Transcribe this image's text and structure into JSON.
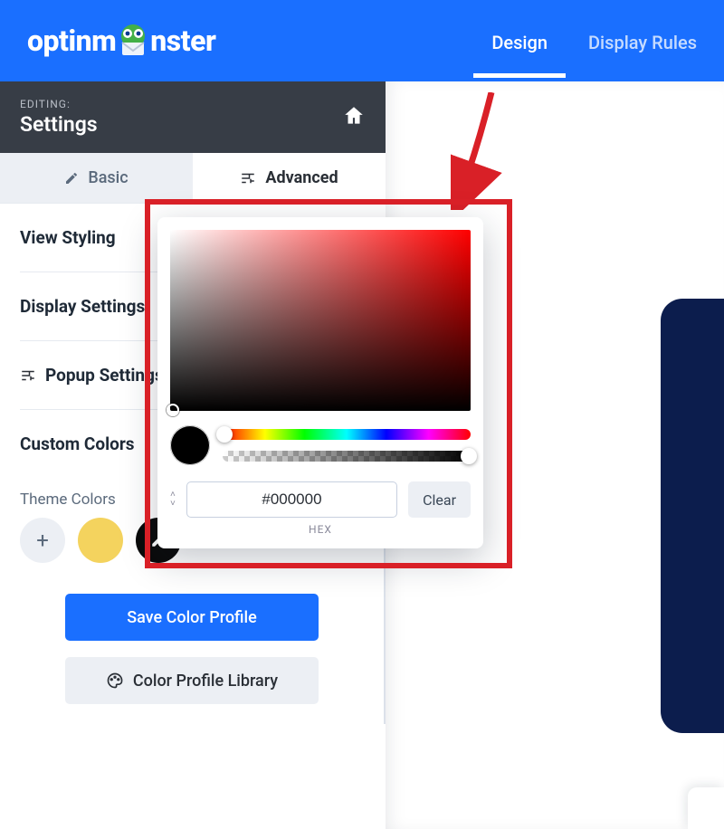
{
  "nav": {
    "design": "Design",
    "display_rules": "Display Rules"
  },
  "logo": {
    "text_a": "optinm",
    "text_b": "nster"
  },
  "editing": {
    "label": "EDITING:",
    "title": "Settings"
  },
  "subtabs": {
    "basic": "Basic",
    "advanced": "Advanced"
  },
  "sections": {
    "view_styling": "View Styling",
    "display_settings": "Display Settings",
    "popup_settings": "Popup Settings",
    "custom_colors": "Custom Colors"
  },
  "theme": {
    "label": "Theme Colors",
    "save_profile": "Save Color Profile",
    "library": "Color Profile Library"
  },
  "picker": {
    "hex_value": "#000000",
    "hex_label": "HEX",
    "clear": "Clear"
  },
  "colors": {
    "accent": "#1a6fff",
    "danger": "#d92027"
  }
}
